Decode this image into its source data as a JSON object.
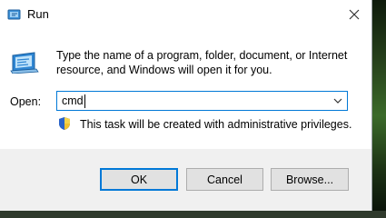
{
  "window": {
    "title": "Run"
  },
  "description": "Type the name of a program, folder, document, or Internet resource, and Windows will open it for you.",
  "open_field": {
    "label": "Open:",
    "value": "cmd"
  },
  "privileges_note": "This task will be created with administrative privileges.",
  "buttons": {
    "ok": "OK",
    "cancel": "Cancel",
    "browse": "Browse..."
  },
  "icons": {
    "title": "run-app-icon",
    "main": "run-app-icon",
    "shield": "uac-shield-icon",
    "dropdown": "chevron-down-icon",
    "close": "close-icon"
  },
  "colors": {
    "accent": "#0078d7",
    "footer_bg": "#f0f0f0"
  }
}
